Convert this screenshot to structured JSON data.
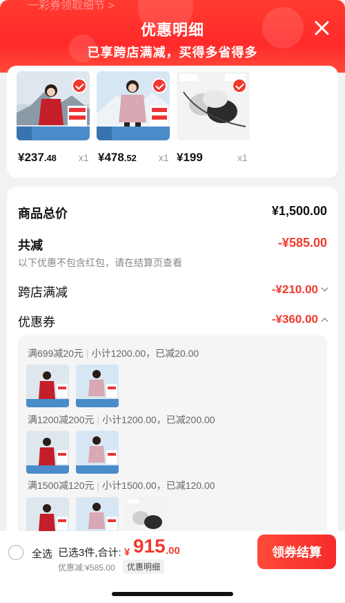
{
  "header": {
    "peek_text": "一彩券领取细节 >",
    "title": "优惠明细",
    "subtitle": "已享跨店满减，买得多省得多",
    "close_icon": "close-icon"
  },
  "products": [
    {
      "price_main": "¥237",
      "price_dec": ".48",
      "qty": "x1",
      "image": "red-jacket-woman"
    },
    {
      "price_main": "¥478",
      "price_dec": ".52",
      "qty": "x1",
      "image": "pink-jacket-woman"
    },
    {
      "price_main": "¥199",
      "price_dec": "",
      "qty": "x1",
      "image": "bra-product"
    }
  ],
  "summary": {
    "total_label": "商品总价",
    "total_value": "¥1,500.00",
    "reduce_label": "共减",
    "reduce_value": "-¥585.00",
    "note": "以下优惠不包含红包，请在结算页查看",
    "cross_label": "跨店满减",
    "cross_value": "-¥210.00",
    "coupon_label": "优惠券",
    "coupon_value": "-¥360.00"
  },
  "coupons": [
    {
      "rule": "满699减20元",
      "detail": "小计1200.00，已减20.00",
      "items": [
        "red-jacket",
        "pink-jacket"
      ]
    },
    {
      "rule": "满1200减200元",
      "detail": "小计1200.00，已减200.00",
      "items": [
        "red-jacket",
        "pink-jacket"
      ]
    },
    {
      "rule": "满1500减120元",
      "detail": "小计1500.00，已减120.00",
      "items": [
        "red-jacket",
        "pink-jacket",
        "bra"
      ]
    }
  ],
  "bottom": {
    "select_all": "全选",
    "selected_text": "已选3件,合计:",
    "currency": "¥",
    "total_int": "915",
    "total_dec": ".00",
    "discount_text": "优惠减:¥585.00",
    "detail_button": "优惠明细",
    "checkout_button": "领券结算"
  },
  "colors": {
    "accent": "#f03a2e",
    "header": "#ff2a2a"
  }
}
